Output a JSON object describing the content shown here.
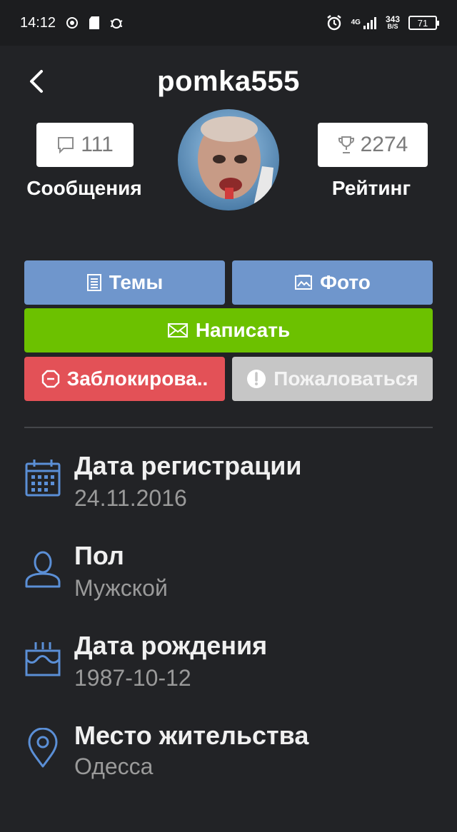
{
  "status_bar": {
    "time": "14:12",
    "network": "4G",
    "speed_value": "343",
    "speed_unit": "B/S",
    "battery": "71"
  },
  "header": {
    "title": "pomka555"
  },
  "stats": {
    "messages": {
      "count": "111",
      "label": "Сообщения"
    },
    "rating": {
      "count": "2274",
      "label": "Рейтинг"
    }
  },
  "actions": {
    "topics": "Темы",
    "photos": "Фото",
    "write": "Написать",
    "block": "Заблокирова..",
    "report": "Пожаловаться"
  },
  "info": [
    {
      "label": "Дата регистрации",
      "value": "24.11.2016",
      "icon": "calendar-icon"
    },
    {
      "label": "Пол",
      "value": "Мужской",
      "icon": "user-icon"
    },
    {
      "label": "Дата рождения",
      "value": "1987-10-12",
      "icon": "cake-icon"
    },
    {
      "label": "Место жительства",
      "value": "Одесса",
      "icon": "location-pin-icon"
    }
  ],
  "colors": {
    "background": "#222326",
    "blue_button": "#6f96cc",
    "green_button": "#6cc100",
    "red_button": "#e35157",
    "gray_button": "#c6c6c6",
    "icon_blue": "#5b8fd6"
  }
}
